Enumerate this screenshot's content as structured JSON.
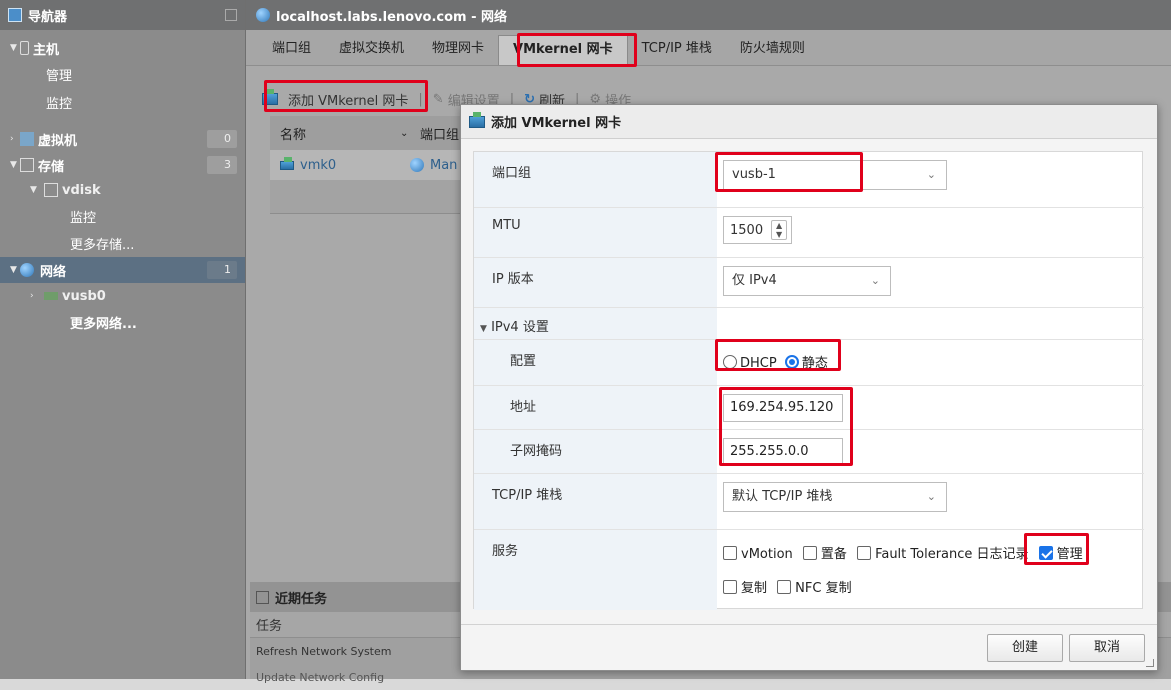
{
  "navigator": {
    "title": "导航器",
    "items": [
      {
        "label": "主机"
      },
      {
        "label": "管理"
      },
      {
        "label": "监控"
      },
      {
        "label": "虚拟机",
        "count": "0"
      },
      {
        "label": "存储",
        "count": "3"
      },
      {
        "label": "vdisk"
      },
      {
        "label": "监控"
      },
      {
        "label": "更多存储..."
      },
      {
        "label": "网络",
        "count": "1"
      },
      {
        "label": "vusb0"
      },
      {
        "label": "更多网络..."
      }
    ]
  },
  "main": {
    "title": "localhost.labs.lenovo.com - 网络",
    "tabs": [
      "端口组",
      "虚拟交换机",
      "物理网卡",
      "VMkernel 网卡",
      "TCP/IP 堆栈",
      "防火墙规则"
    ],
    "active_tab": "VMkernel 网卡",
    "toolbar": {
      "add": "添加 VMkernel 网卡",
      "edit": "编辑设置",
      "refresh": "刷新",
      "actions": "操作"
    },
    "grid": {
      "columns": [
        "名称",
        "端口组"
      ],
      "rows": [
        {
          "name": "vmk0",
          "portgroup": "Man"
        }
      ]
    },
    "tasks": {
      "title": "近期任务",
      "column": "任务",
      "rows": [
        "Refresh Network System",
        "Update Network Config"
      ]
    }
  },
  "dialog": {
    "title": "添加 VMkernel 网卡",
    "portgroup_label": "端口组",
    "portgroup_value": "vusb-1",
    "mtu_label": "MTU",
    "mtu_value": "1500",
    "ipver_label": "IP 版本",
    "ipver_value": "仅 IPv4",
    "ipv4_section": "IPv4 设置",
    "config_label": "配置",
    "dhcp_label": "DHCP",
    "static_label": "静态",
    "address_label": "地址",
    "address_value": "169.254.95.120",
    "mask_label": "子网掩码",
    "mask_value": "255.255.0.0",
    "stack_label": "TCP/IP 堆栈",
    "stack_value": "默认 TCP/IP 堆栈",
    "services_label": "服务",
    "services": {
      "vmotion": "vMotion",
      "provisioning": "置备",
      "ft": "Fault Tolerance 日志记录",
      "management": "管理",
      "replication": "复制",
      "nfc": "NFC 复制"
    },
    "create_button": "创建",
    "cancel_button": "取消"
  },
  "colors": {
    "accent": "#1a73e8",
    "highlight": "#e0001b",
    "nav_selected": "#5c7083"
  }
}
